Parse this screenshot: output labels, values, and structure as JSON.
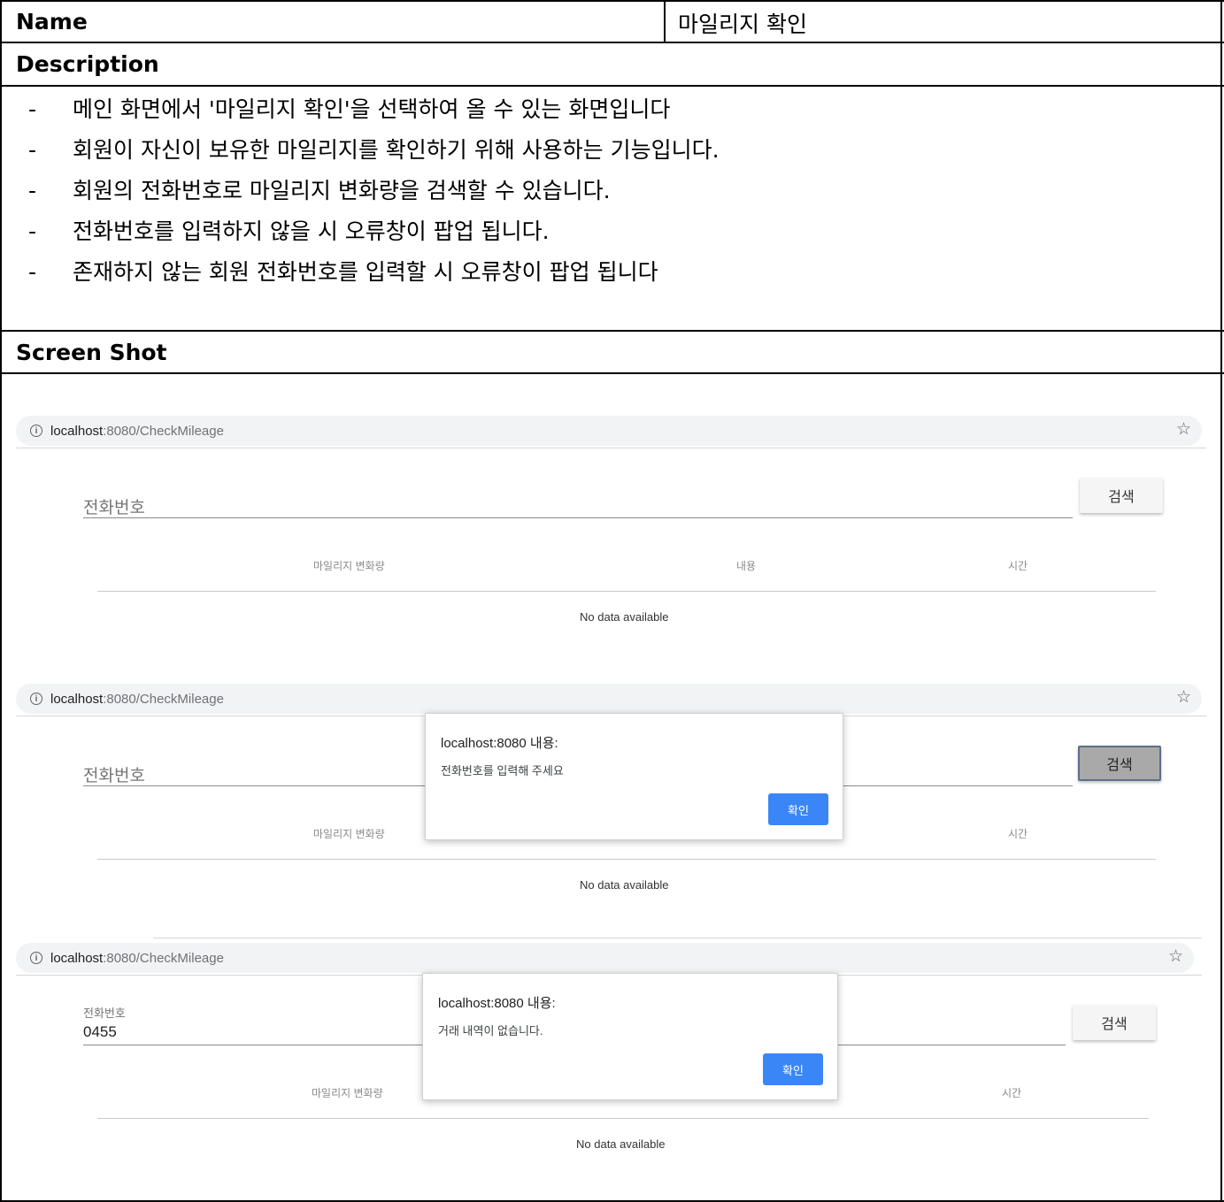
{
  "table": {
    "name_label": "Name",
    "name_value": "마일리지 확인",
    "description_label": "Description",
    "screenshot_label": "Screen Shot"
  },
  "description": {
    "bullet": "-",
    "items": [
      "메인 화면에서 '마일리지 확인'을 선택하여 올 수 있는 화면입니다",
      "회원이 자신이 보유한 마일리지를 확인하기 위해 사용하는 기능입니다.",
      "회원의 전화번호로 마일리지 변화량을 검색할 수 있습니다.",
      "전화번호를 입력하지 않을 시 오류창이 팝업 됩니다.",
      "존재하지 않는 회원 전화번호를 입력할 시 오류창이 팝업 됩니다"
    ]
  },
  "browser": {
    "url_host": "localhost",
    "url_path": ":8080/CheckMileage",
    "info_icon": "info-icon",
    "star_icon": "star-icon"
  },
  "app": {
    "phone_label": "전화번호",
    "search_button": "검색",
    "columns": [
      "마일리지 변화량",
      "내용",
      "시간"
    ],
    "no_data": "No data available"
  },
  "screens": [
    {
      "phone_value": ""
    },
    {
      "phone_value": "",
      "dialog": {
        "title": "localhost:8080 내용:",
        "message": "전화번호를 입력해 주세요",
        "ok": "확인"
      }
    },
    {
      "phone_value": "0455",
      "dialog": {
        "title": "localhost:8080 내용:",
        "message": "거래 내역이 없습니다.",
        "ok": "확인"
      }
    }
  ]
}
